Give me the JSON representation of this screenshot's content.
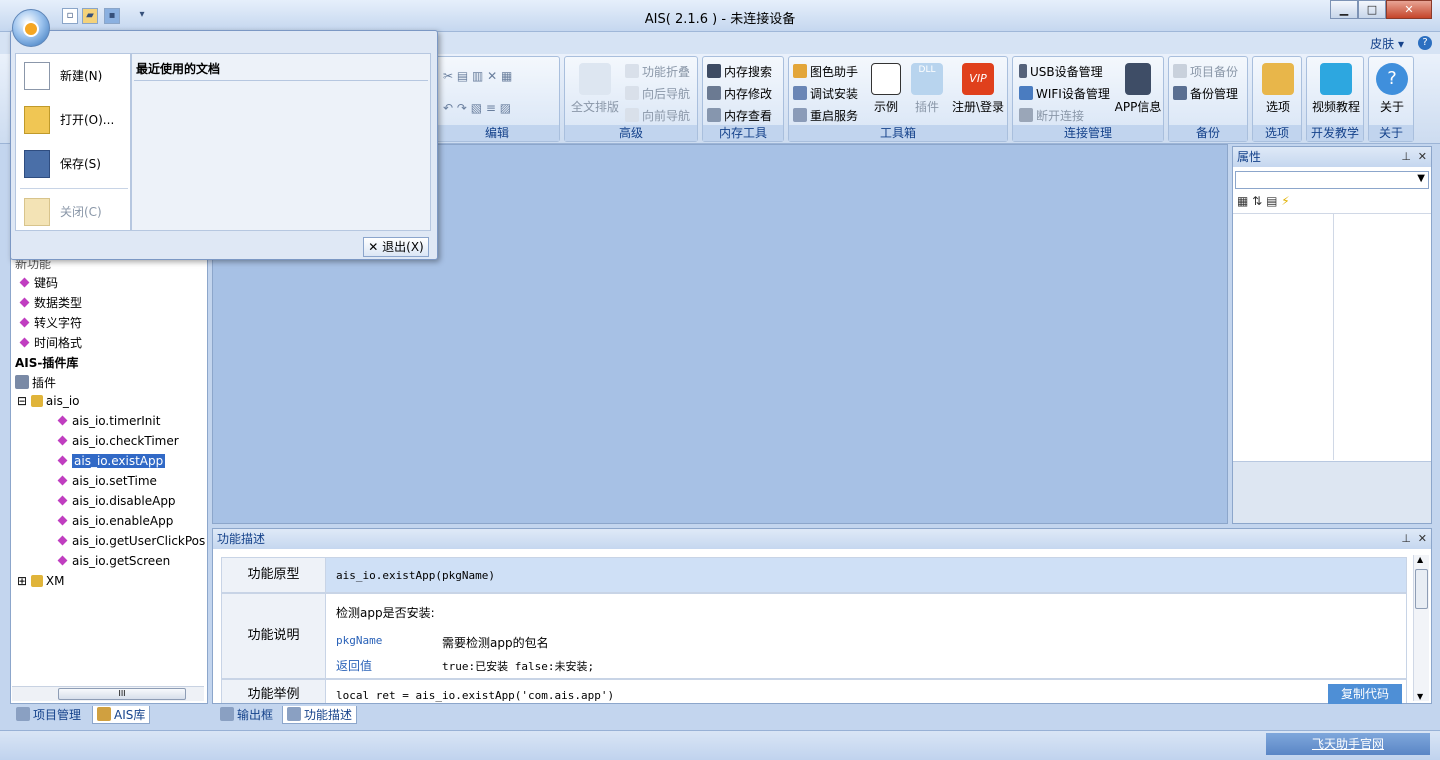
{
  "window": {
    "title": "AIS( 2.1.6 ) - 未连接设备",
    "minimize": "▁",
    "maximize": "□",
    "close": "✕"
  },
  "qat": {
    "new_glyph": "▫",
    "open_glyph": "▰",
    "save_glyph": "▪",
    "more_glyph": "▾"
  },
  "ribbon_top": {
    "skin": "皮肤 ▾",
    "help": "?"
  },
  "ribbon": {
    "edit_label": "编辑",
    "advanced": {
      "label": "高级",
      "full_sort": "全文排版",
      "fold": "功能折叠",
      "back_nav": "向后导航",
      "fwd_nav": "向前导航"
    },
    "memory": {
      "label": "内存工具",
      "search": "内存搜索",
      "modify": "内存修改",
      "view": "内存查看"
    },
    "toolbox": {
      "label": "工具箱",
      "color_helper": "图色助手",
      "debug_install": "调试安装",
      "restart": "重启服务",
      "example": "示例",
      "plugin": "插件",
      "vip_login": "注册\\登录",
      "vip_text": "VIP",
      "dll_text": "DLL"
    },
    "connection": {
      "label": "连接管理",
      "usb": "USB设备管理",
      "wifi": "WIFI设备管理",
      "disconnect": "断开连接",
      "app_info": "APP信息"
    },
    "backup": {
      "label": "备份",
      "project_backup": "项目备份",
      "backup_manage": "备份管理"
    },
    "options": {
      "label": "选项",
      "btn": "选项"
    },
    "dev_teach": {
      "label": "开发教学",
      "btn": "视频教程"
    },
    "about": {
      "label": "关于",
      "btn": "关于"
    }
  },
  "app_menu": {
    "new": "新建(N)",
    "open": "打开(O)...",
    "save": "保存(S)",
    "close": "关闭(C)",
    "recent_title": "最近使用的文档",
    "exit": "退出(X)"
  },
  "tree": {
    "partial_top": "新功能",
    "items": [
      "键码",
      "数据类型",
      "转义字符",
      "时间格式"
    ],
    "plugin_lib_title": "AIS-插件库",
    "plugin_root": "插件",
    "ais_io": "ais_io",
    "ais_io_children": [
      "ais_io.timerInit",
      "ais_io.checkTimer",
      "ais_io.existApp",
      "ais_io.setTime",
      "ais_io.disableApp",
      "ais_io.enableApp",
      "ais_io.getUserClickPos",
      "ais_io.getScreen"
    ],
    "xm": "XM"
  },
  "left_tabs": {
    "project": "项目管理",
    "ais_lib": "AIS库"
  },
  "property_panel": {
    "title": "属性"
  },
  "desc_panel": {
    "title": "功能描述",
    "prototype_label": "功能原型",
    "prototype_value": "ais_io.existApp(pkgName)",
    "explain_label": "功能说明",
    "explain_text": "检测app是否安装:",
    "param_name": "pkgName",
    "param_desc": "需要检测app的包名",
    "return_name": "返回值",
    "return_desc": "true:已安装 false:未安装;",
    "example_label": "功能举例",
    "example_code": "local ret = ais_io.existApp('com.ais.app')",
    "copy_btn": "复制代码"
  },
  "bottom_tabs": {
    "output": "输出框",
    "func_desc": "功能描述"
  },
  "status": {
    "site_link": "飞天助手官网"
  }
}
